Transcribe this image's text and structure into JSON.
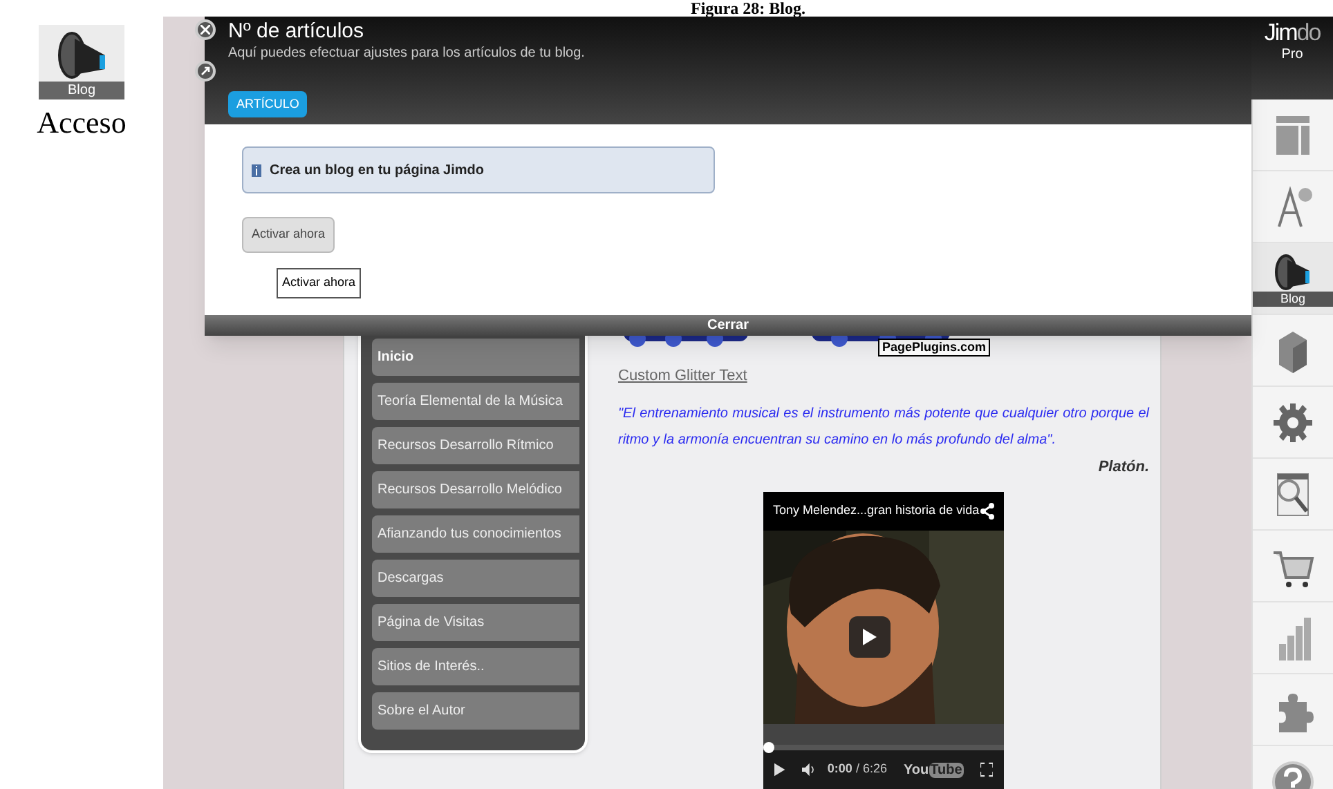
{
  "caption": "Figura 28: Blog.",
  "access": {
    "icon_label": "Blog",
    "label": "Acceso"
  },
  "panel": {
    "title": "Nº de artículos",
    "subtitle": "Aquí puedes efectuar ajustes para los artículos de tu blog.",
    "tabs": [
      {
        "label": "ARTÍCULO",
        "selected": true
      }
    ],
    "notice": "Crea un blog en tu página Jimdo",
    "button": "Activar ahora",
    "tooltip": "Activar ahora",
    "close_bar": "Cerrar"
  },
  "brand": {
    "name_a": "Jim",
    "name_b": "do",
    "plan": "Pro"
  },
  "toolbar": [
    {
      "kind": "layout",
      "selected": false
    },
    {
      "kind": "style",
      "selected": false
    },
    {
      "kind": "blog",
      "label": "Blog",
      "selected": true
    },
    {
      "kind": "box",
      "selected": false
    },
    {
      "kind": "gear",
      "selected": false
    },
    {
      "kind": "seo",
      "selected": false
    },
    {
      "kind": "cart",
      "selected": false
    },
    {
      "kind": "stats",
      "selected": false
    },
    {
      "kind": "puzzle",
      "selected": false
    },
    {
      "kind": "help",
      "selected": false
    }
  ],
  "site": {
    "nav": [
      {
        "label": "Inicio",
        "selected": true
      },
      {
        "label": "Teoría Elemental de la Música",
        "selected": false
      },
      {
        "label": "Recursos Desarrollo Rítmico",
        "selected": false
      },
      {
        "label": "Recursos Desarrollo Melódico",
        "selected": false
      },
      {
        "label": "Afianzando tus conocimientos",
        "selected": false
      },
      {
        "label": "Descargas",
        "selected": false
      },
      {
        "label": "Página de Visitas",
        "selected": false
      },
      {
        "label": "Sitios de Interés..",
        "selected": false
      },
      {
        "label": "Sobre el Autor",
        "selected": false
      }
    ],
    "badge": "PagePlugins.com",
    "link": "Custom Glitter Text",
    "quote": "\"El entrenamiento musical es el instrumento más potente que cualquier otro porque el ritmo y la armonía encuentran su camino en lo más profundo del alma\".",
    "author": "Platón.",
    "video": {
      "title": "Tony Melendez...gran historia de vida",
      "time": "**0:00** / 6:26",
      "logo_a": "You",
      "logo_b": "Tube",
      "level": 0
    }
  }
}
